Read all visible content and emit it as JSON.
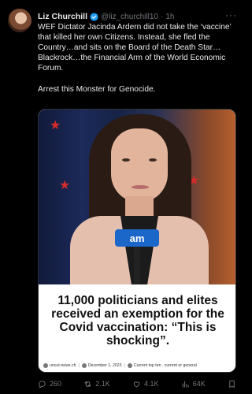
{
  "tweet": {
    "author_name": "Liz Churchill",
    "handle": "@liz_churchill10",
    "separator": "·",
    "time": "1h",
    "text": "WEF Dictator Jacinda Ardern did not take the ‘vaccine’ that killed her own Citizens. Instead, she fled the Country…and sits on the Board of the Death Star…Blackrock…the Financial Arm of the World Economic Forum.\n\nArrest this Monster for Genocide.",
    "more_label": "···"
  },
  "media": {
    "mic_logo": "am",
    "headline": "11,000 politicians and elites received an exemption for the Covid vaccination: “This is shocking”.",
    "meta": {
      "site": "uncut-news.ch",
      "date": "December 1, 2023",
      "category": "Current top ten . current or general"
    }
  },
  "actions": {
    "replies": "260",
    "reposts": "2.1K",
    "likes": "4.1K",
    "views": "64K"
  },
  "colors": {
    "background": "#000000",
    "text_primary": "#e7e9ea",
    "text_secondary": "#71767b",
    "verified": "#1d9bf0"
  }
}
